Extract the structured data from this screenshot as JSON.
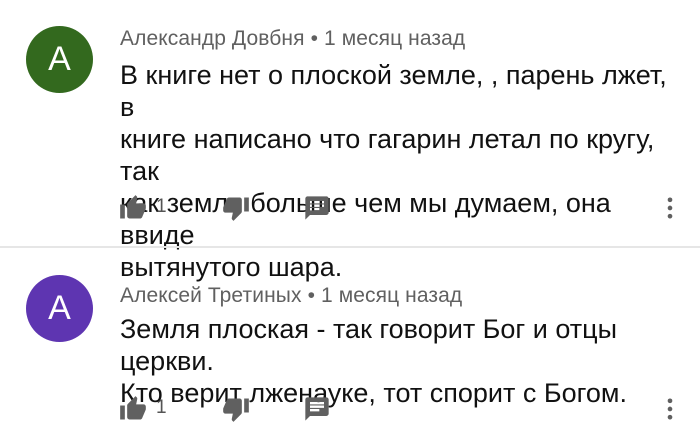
{
  "comments": [
    {
      "avatar_letter": "A",
      "avatar_color": "#33691e",
      "author": "Александр Довбня",
      "separator": "•",
      "time": "1 месяц назад",
      "text": "В книге нет о плоской земле, ,  парень лжет,  в\nкниге написано что гагарин летал по кругу,  так\nкак земля больше чем мы думаем,  она ввиде\nвытянутого шара.",
      "likes": "1"
    },
    {
      "avatar_letter": "A",
      "avatar_color": "#5e35b1",
      "author": "Алексей Третиных",
      "separator": "•",
      "time": "1 месяц назад",
      "text": "Земля плоская - так говорит Бог и отцы церкви.\nКто верит лженауке,  тот спорит с Богом.",
      "likes": "1"
    }
  ],
  "icons": {
    "like": "thumb-up-icon",
    "dislike": "thumb-down-icon",
    "reply": "comment-icon",
    "more": "more-vert-icon"
  },
  "colors": {
    "icon": "#606060",
    "meta_text": "#606060",
    "divider": "#e6e6e6"
  }
}
